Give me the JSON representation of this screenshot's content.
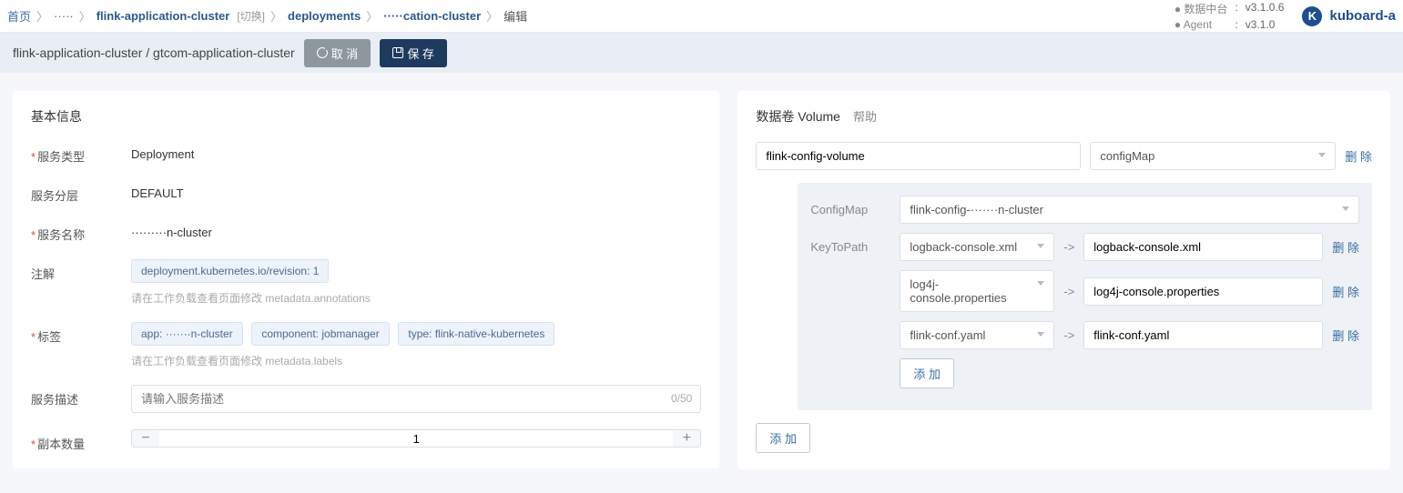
{
  "breadcrumb": {
    "home": "首页",
    "cluster1": "·····",
    "app": "flink-application-cluster",
    "switch": "[切换]",
    "deployments": "deployments",
    "deploy_name": "·····cation-cluster",
    "edit": "编辑"
  },
  "versions": {
    "platform_label": "数据中台",
    "platform_ver": "v3.1.0.6",
    "agent_label": "Agent",
    "agent_ver": "v3.1.0",
    "colon": ":"
  },
  "brand": "kuboard-a",
  "titlebar": {
    "path": "flink-application-cluster / gtcom-application-cluster",
    "cancel": "取 消",
    "save": "保 存"
  },
  "basic": {
    "title": "基本信息",
    "service_type_label": "服务类型",
    "service_type_value": "Deployment",
    "layer_label": "服务分层",
    "layer_value": "DEFAULT",
    "service_name_label": "服务名称",
    "service_name_value": "·········n-cluster",
    "anno_label": "注解",
    "anno_tag": "deployment.kubernetes.io/revision: 1",
    "anno_hint": "请在工作负载查看页面修改 metadata.annotations",
    "labels_label": "标签",
    "label_tags": {
      "app": "app: ·······n-cluster",
      "component": "component: jobmanager",
      "type": "type: flink-native-kubernetes"
    },
    "labels_hint": "请在工作负载查看页面修改 metadata.labels",
    "desc_label": "服务描述",
    "desc_placeholder": "请输入服务描述",
    "desc_count": "0/50",
    "replicas_label": "副本数量",
    "replicas_value": "1"
  },
  "volume": {
    "title": "数据卷 Volume",
    "help": "帮助",
    "name": "flink-config-volume",
    "type": "configMap",
    "configmap_label": "ConfigMap",
    "configmap_value": "flink-config-·······n-cluster",
    "ktp_label": "KeyToPath",
    "delete": "删 除",
    "arrow": "->",
    "add_item": "添 加",
    "add_volume": "添 加",
    "items": [
      {
        "key": "logback-console.xml",
        "path": "logback-console.xml"
      },
      {
        "key": "log4j-console.properties",
        "path": "log4j-console.properties"
      },
      {
        "key": "flink-conf.yaml",
        "path": "flink-conf.yaml"
      }
    ]
  }
}
